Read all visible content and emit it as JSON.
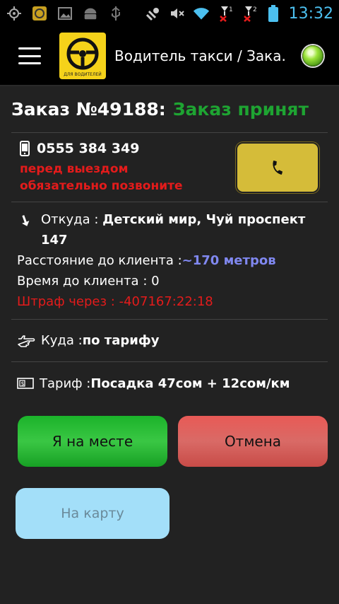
{
  "status_bar": {
    "time": "13:32",
    "sim1": "1",
    "sim2": "2"
  },
  "action_bar": {
    "title": "Водитель такси / Зака...",
    "logo_caption": "ДЛЯ ВОДИТЕЛЕЙ",
    "indicator_color": "#7ed321"
  },
  "order": {
    "number": "Заказ №49188:",
    "status": "Заказ принят",
    "status_color": "#1ea432"
  },
  "contact": {
    "phone": "0555 384 349",
    "warning_line1": "перед выездом",
    "warning_line2": "обязательно позвоните"
  },
  "pickup": {
    "from_label": "Откуда : ",
    "from_value_line1": "Детский мир,  Чуй проспект",
    "from_value_line2": "147",
    "distance_label": "Расстояние до клиента :",
    "distance_value": "~170 метров",
    "time_label": "Время до клиента : 0",
    "fine": "Штраф через : -407167:22:18"
  },
  "destination": {
    "label": "Куда : ",
    "value": "по тарифу"
  },
  "tariff": {
    "label": "Тариф : ",
    "value": "Посадка 47сом + 12сом/км"
  },
  "buttons": {
    "arrived": "Я на месте",
    "cancel": "Отмена",
    "map": "На карту"
  }
}
